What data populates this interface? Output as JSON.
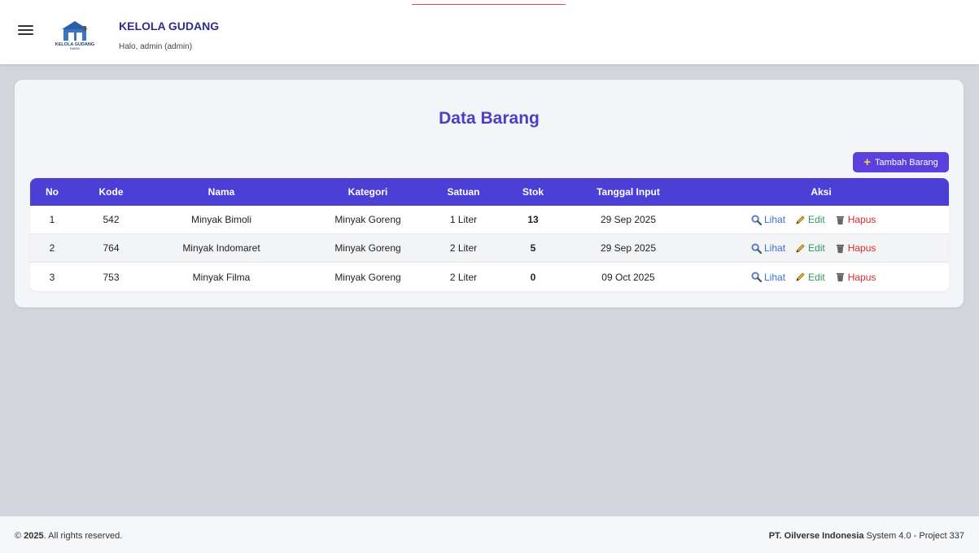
{
  "header": {
    "brand_title": "KELOLA GUDANG",
    "greeting": "Halo, admin (admin)",
    "logo_text": "KELOLA GUDANG",
    "logo_subtext": "PABRIK"
  },
  "main": {
    "title": "Data Barang",
    "add_button_label": "Tambah Barang",
    "columns": {
      "no": "No",
      "kode": "Kode",
      "nama": "Nama",
      "kategori": "Kategori",
      "satuan": "Satuan",
      "stok": "Stok",
      "tanggal": "Tanggal Input",
      "aksi": "Aksi"
    },
    "rows": [
      {
        "no": "1",
        "kode": "542",
        "nama": "Minyak Bimoli",
        "kategori": "Minyak Goreng",
        "satuan": "1 Liter",
        "stok": "13",
        "tanggal": "29 Sep 2025"
      },
      {
        "no": "2",
        "kode": "764",
        "nama": "Minyak Indomaret",
        "kategori": "Minyak Goreng",
        "satuan": "2 Liter",
        "stok": "5",
        "tanggal": "29 Sep 2025"
      },
      {
        "no": "3",
        "kode": "753",
        "nama": "Minyak Filma",
        "kategori": "Minyak Goreng",
        "satuan": "2 Liter",
        "stok": "0",
        "tanggal": "09 Oct 2025"
      }
    ],
    "actions": {
      "view": "Lihat",
      "edit": "Edit",
      "delete": "Hapus"
    }
  },
  "footer": {
    "year": "2025",
    "rights": ". All rights reserved.",
    "copyright_symbol": "©",
    "company": "PT. Oilverse Indonesia",
    "version": " System 4.0 - Project 337"
  },
  "colors": {
    "primary": "#4c3fd6",
    "title": "#4b3fc6",
    "brand": "#2f2c8f",
    "view": "#3b6fd4",
    "edit": "#2f9a57",
    "delete": "#d62b2b"
  }
}
